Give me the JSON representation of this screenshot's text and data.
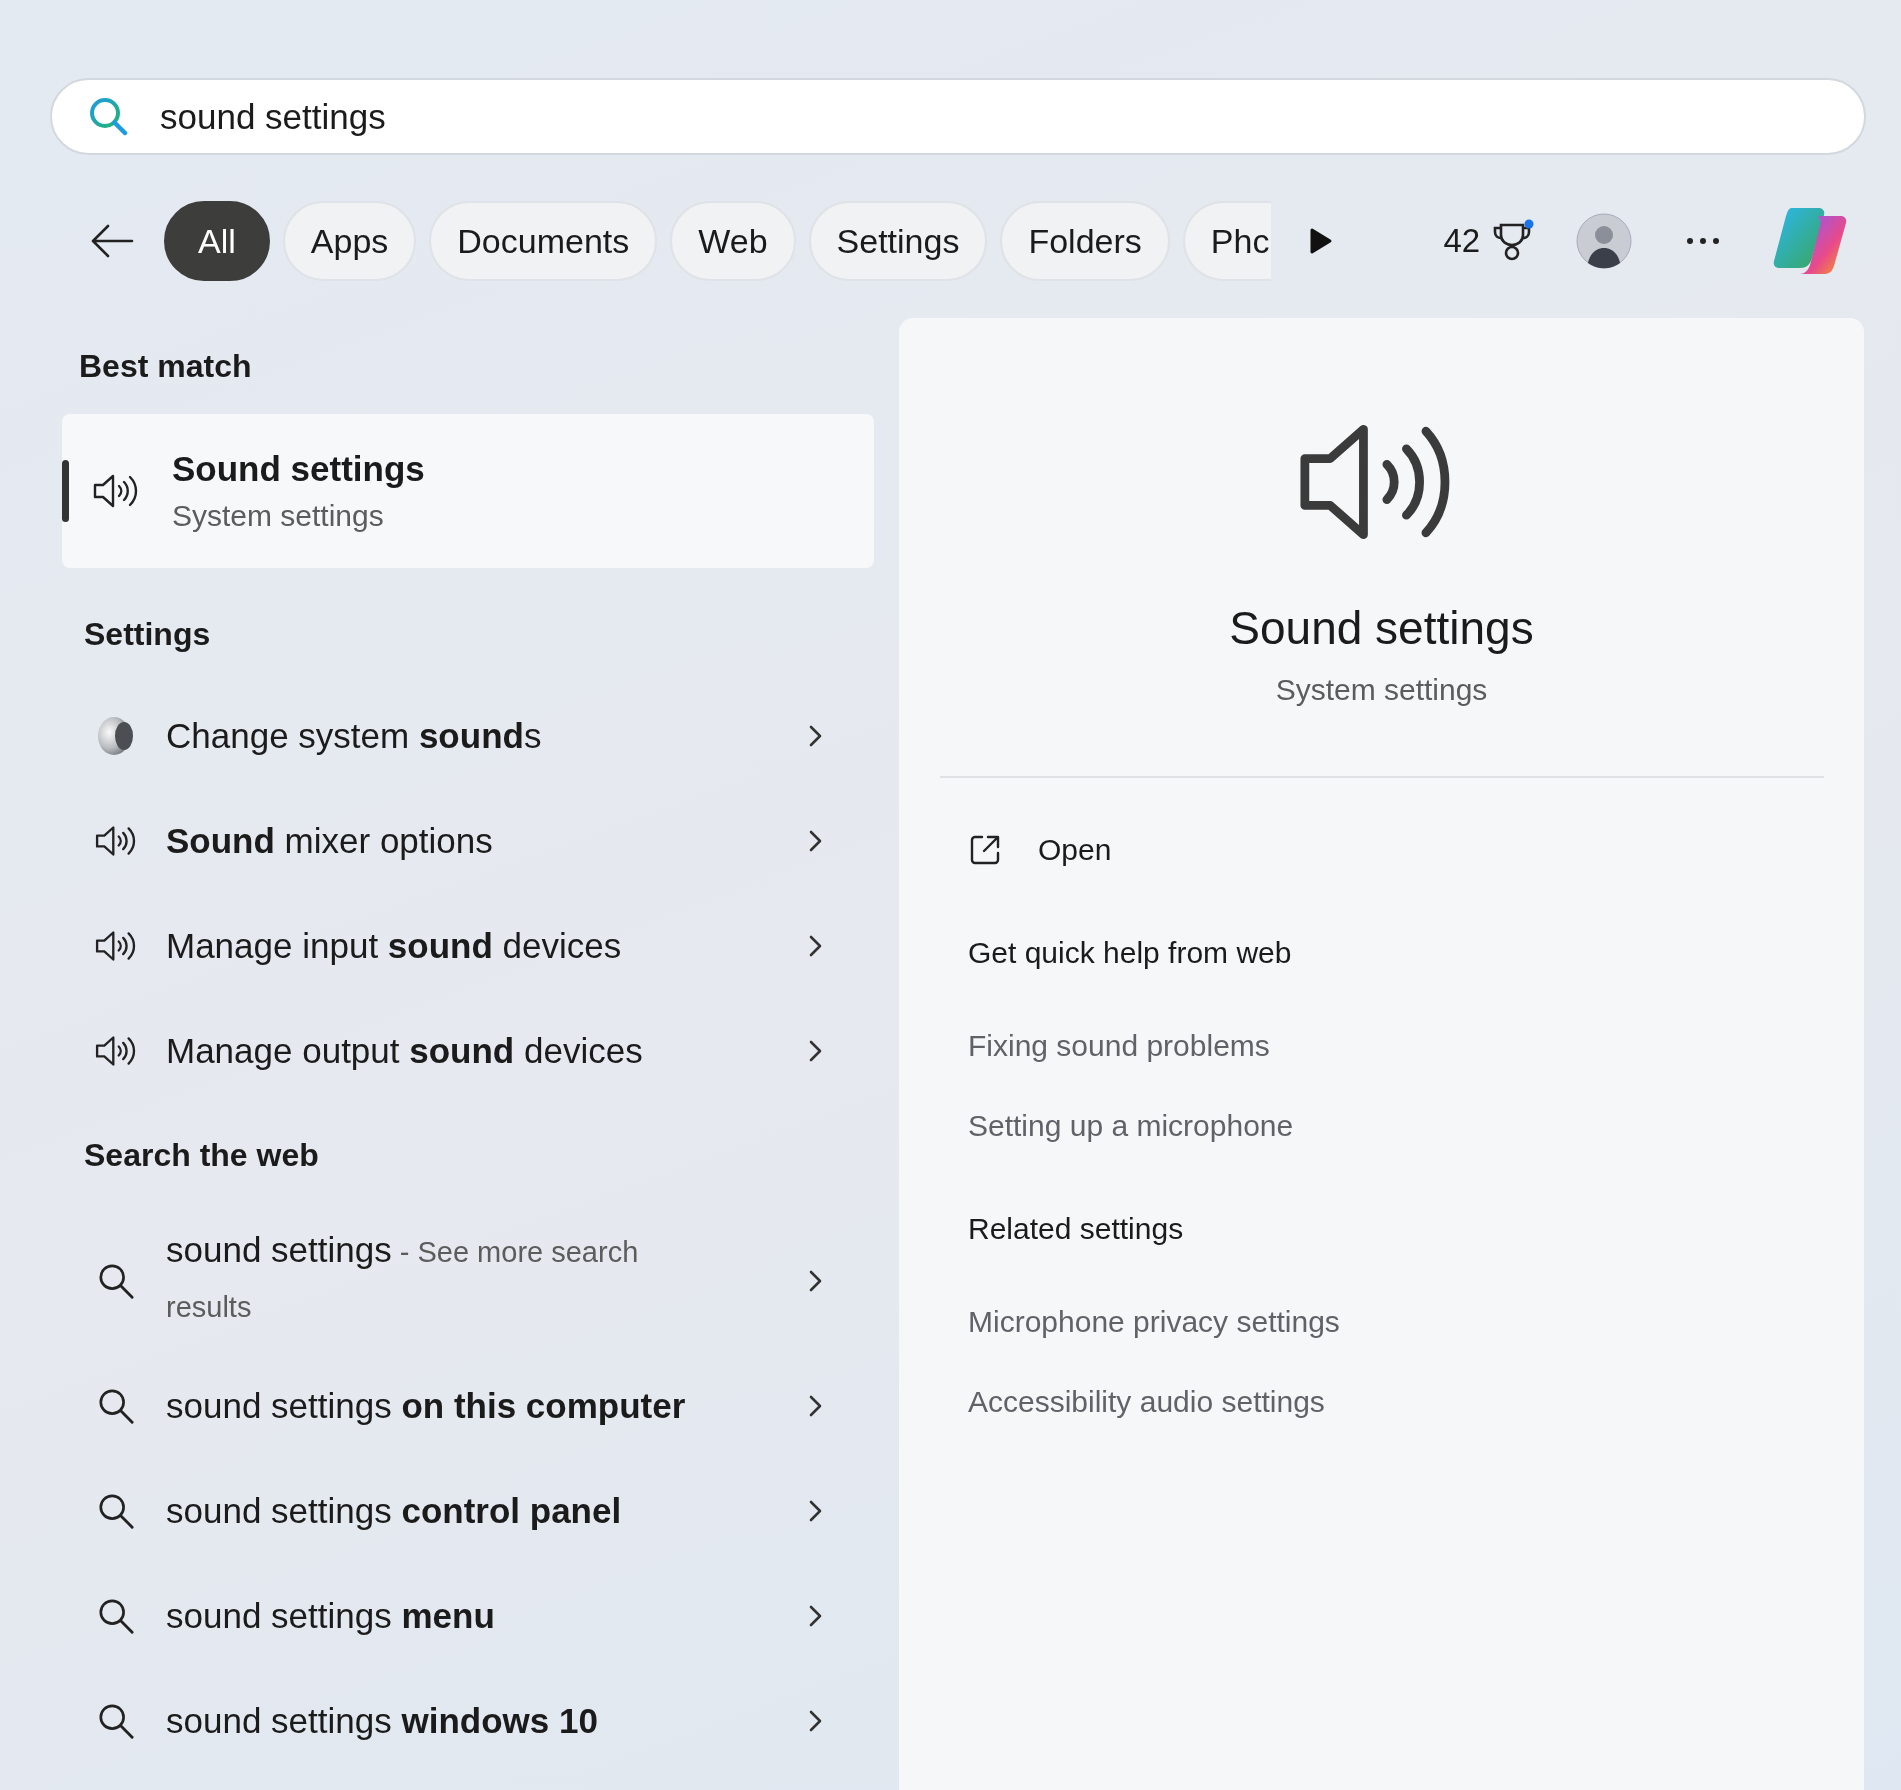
{
  "search": {
    "value": "sound settings"
  },
  "filters": [
    {
      "label": "All",
      "selected": true
    },
    {
      "label": "Apps",
      "selected": false
    },
    {
      "label": "Documents",
      "selected": false
    },
    {
      "label": "Web",
      "selected": false
    },
    {
      "label": "Settings",
      "selected": false
    },
    {
      "label": "Folders",
      "selected": false
    },
    {
      "label": "Phc",
      "selected": false
    }
  ],
  "rewards": {
    "points": "42",
    "notification": true
  },
  "best_match": {
    "heading": "Best match",
    "title": "Sound settings",
    "subtitle": "System settings",
    "selected": true
  },
  "settings": {
    "heading": "Settings",
    "items": [
      {
        "kind": "legacy",
        "text": "Change system **sound**s"
      },
      {
        "kind": "speaker",
        "text": "**Sound** mixer options"
      },
      {
        "kind": "speaker",
        "text": "Manage input **sound** devices"
      },
      {
        "kind": "speaker",
        "text": "Manage output **sound** devices"
      }
    ]
  },
  "web": {
    "heading": "Search the web",
    "items": [
      {
        "text": "sound settings",
        "suffix": "- See more search results"
      },
      {
        "text": "sound settings **on this computer**"
      },
      {
        "text": "sound settings **control panel**"
      },
      {
        "text": "sound settings **menu**"
      },
      {
        "text": "sound settings **windows 10**"
      }
    ]
  },
  "detail": {
    "title": "Sound settings",
    "subtitle": "System settings",
    "open": "Open",
    "help_heading": "Get quick help from web",
    "help_links": [
      "Fixing sound problems",
      "Setting up a microphone"
    ],
    "related_heading": "Related settings",
    "related_links": [
      "Microphone privacy settings",
      "Accessibility audio settings"
    ]
  }
}
